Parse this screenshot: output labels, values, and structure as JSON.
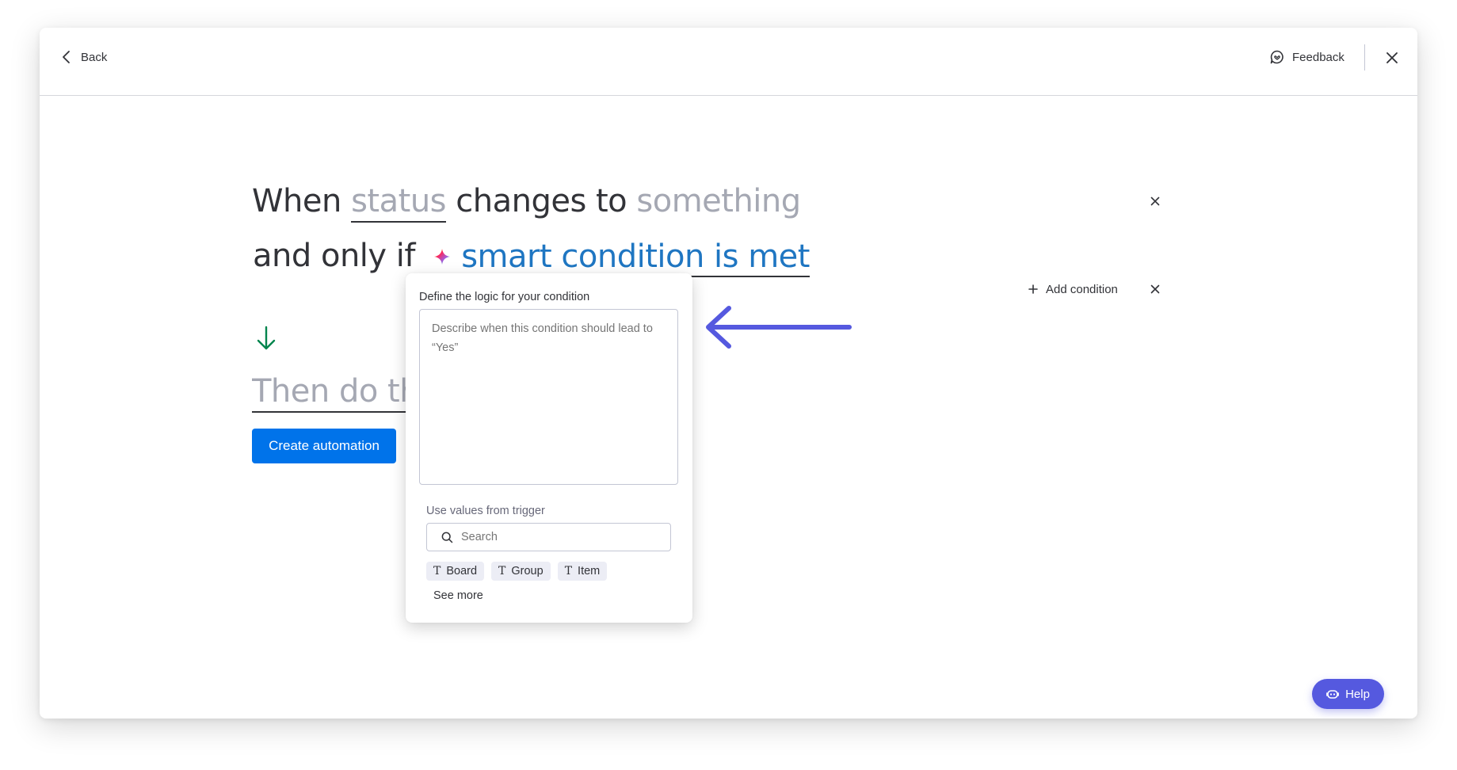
{
  "header": {
    "back_label": "Back",
    "feedback_label": "Feedback"
  },
  "trigger": {
    "when": "When",
    "column": "status",
    "changes_to": "changes to",
    "value": "something"
  },
  "condition": {
    "prefix": "and only if",
    "smart_label": "smart condition is met",
    "add_condition_label": "Add condition"
  },
  "action": {
    "then_label": "Then do this"
  },
  "create_button": "Create automation",
  "popover": {
    "title": "Define the logic for your condition",
    "textarea_placeholder": "Describe when this condition should lead to “Yes”",
    "values_title": "Use values from trigger",
    "search_placeholder": "Search",
    "chips": [
      {
        "icon": "T",
        "label": "Board"
      },
      {
        "icon": "T",
        "label": "Group"
      },
      {
        "icon": "T",
        "label": "Item"
      }
    ],
    "see_more": "See more"
  },
  "help_label": "Help",
  "colors": {
    "primary": "#0073ea",
    "smart_link": "#1f76c2",
    "annotation_arrow": "#5559df",
    "down_arrow": "#00854d",
    "help_button": "#5559df"
  },
  "icons": {
    "back": "chevron-left-icon",
    "feedback": "feedback-chat-icon",
    "close": "close-icon",
    "sparkle": "ai-sparkle-icon",
    "add": "plus-icon",
    "down_arrow": "arrow-down-icon",
    "search": "search-icon",
    "text_type": "text-type-icon",
    "help": "help-robot-icon",
    "annotation": "arrow-left-annotation"
  }
}
